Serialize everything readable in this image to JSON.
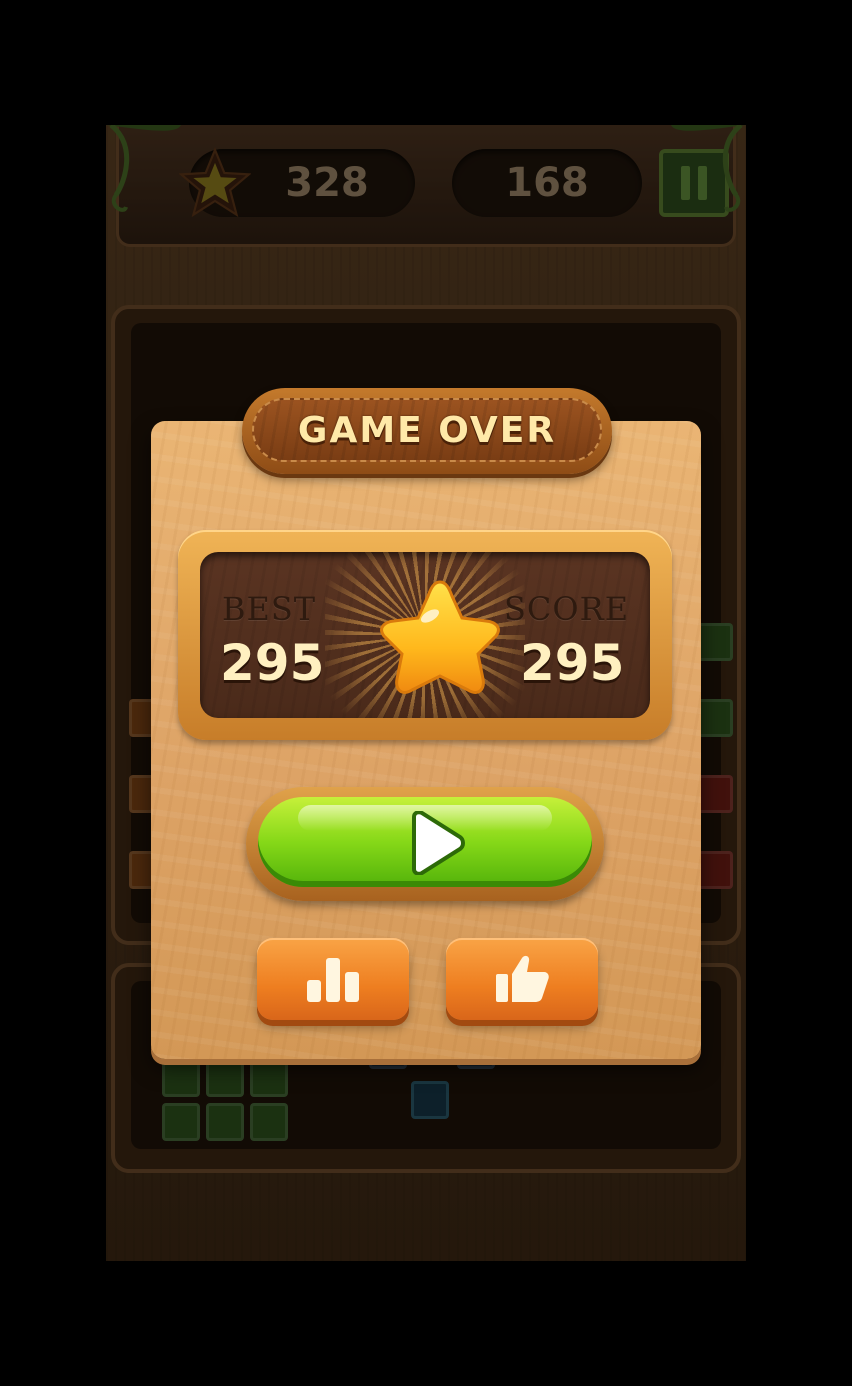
{
  "hud": {
    "coins": "328",
    "level": "168",
    "coin_icon": "star-coin-icon",
    "pause_icon": "pause-icon"
  },
  "dialog": {
    "title": "GAME OVER",
    "best_label": "BEST",
    "best_value": "295",
    "score_label": "SCORE",
    "score_value": "295",
    "play_icon": "play-icon",
    "leaderboard_icon": "leaderboard-icon",
    "rate_icon": "thumbs-up-icon"
  },
  "colors": {
    "dialog_wood": "#dda366",
    "banner_brown": "#8e4c16",
    "play_green": "#86d818",
    "action_orange": "#ee7e20",
    "score_text": "#fff0c0"
  }
}
